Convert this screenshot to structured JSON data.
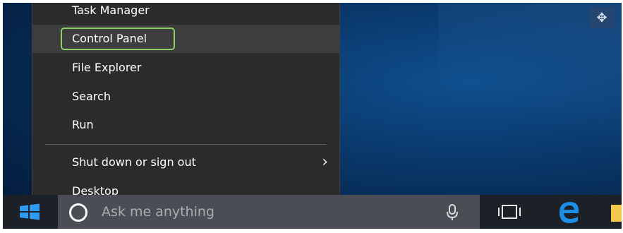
{
  "menu": {
    "items": [
      {
        "label": "Task Manager"
      },
      {
        "label": "Control Panel"
      },
      {
        "label": "File Explorer"
      },
      {
        "label": "Search"
      },
      {
        "label": "Run"
      },
      {
        "label": "Shut down or sign out"
      },
      {
        "label": "Desktop"
      }
    ],
    "focused_item": "Control Panel",
    "submenu_chevron": "›"
  },
  "taskbar": {
    "search_placeholder": "Ask me anything"
  },
  "colors": {
    "menu_background": "#2b2b2b",
    "menu_highlight": "#3d3d3d",
    "focus_ring": "#8fcf6a",
    "taskbar": "#1c2127",
    "search_box": "#4a4e54",
    "start_logo": "#2f9bf0",
    "edge_logo": "#1b8fe8",
    "desktop": "#0a3a6e"
  }
}
